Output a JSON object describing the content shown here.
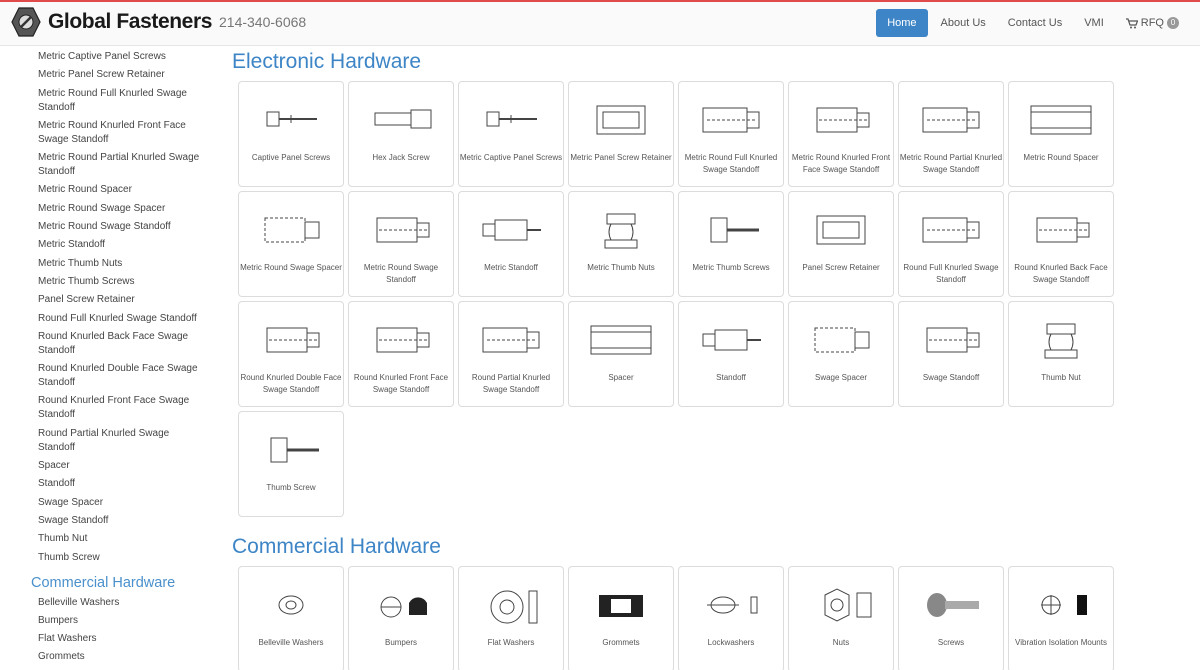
{
  "header": {
    "brand": "Global Fasteners",
    "phone": "214-340-6068",
    "nav": [
      {
        "label": "Home",
        "active": true
      },
      {
        "label": "About Us",
        "active": false
      },
      {
        "label": "Contact Us",
        "active": false
      },
      {
        "label": "VMI",
        "active": false
      }
    ],
    "rfq_label": "RFQ",
    "rfq_count": "0"
  },
  "sidebar": {
    "electronic_items": [
      "Metric Captive Panel Screws",
      "Metric Panel Screw Retainer",
      "Metric Round Full Knurled Swage Standoff",
      "Metric Round Knurled Front Face Swage Standoff",
      "Metric Round Partial Knurled Swage Standoff",
      "Metric Round Spacer",
      "Metric Round Swage Spacer",
      "Metric Round Swage Standoff",
      "Metric Standoff",
      "Metric Thumb Nuts",
      "Metric Thumb Screws",
      "Panel Screw Retainer",
      "Round Full Knurled Swage Standoff",
      "Round Knurled Back Face Swage Standoff",
      "Round Knurled Double Face Swage Standoff",
      "Round Knurled Front Face Swage Standoff",
      "Round Partial Knurled Swage Standoff",
      "Spacer",
      "Standoff",
      "Swage Spacer",
      "Swage Standoff",
      "Thumb Nut",
      "Thumb Screw"
    ],
    "commercial_heading": "Commercial Hardware",
    "commercial_items": [
      "Belleville Washers",
      "Bumpers",
      "Flat Washers",
      "Grommets"
    ]
  },
  "main": {
    "electronic_title": "Electronic Hardware",
    "electronic_cards": [
      {
        "label": "Captive Panel Screws",
        "icon": "captive-screw"
      },
      {
        "label": "Hex Jack Screw",
        "icon": "hex-jack"
      },
      {
        "label": "Metric Captive Panel Screws",
        "icon": "captive-screw"
      },
      {
        "label": "Metric Panel Screw Retainer",
        "icon": "retainer"
      },
      {
        "label": "Metric Round Full Knurled Swage Standoff",
        "icon": "knurled"
      },
      {
        "label": "Metric Round Knurled Front Face Swage Standoff",
        "icon": "standoff"
      },
      {
        "label": "Metric Round Partial Knurled Swage Standoff",
        "icon": "knurled"
      },
      {
        "label": "Metric Round Spacer",
        "icon": "spacer"
      },
      {
        "label": "Metric Round Swage Spacer",
        "icon": "swage-spacer"
      },
      {
        "label": "Metric Round Swage Standoff",
        "icon": "standoff"
      },
      {
        "label": "Metric Standoff",
        "icon": "threaded"
      },
      {
        "label": "Metric Thumb Nuts",
        "icon": "thumb-nut"
      },
      {
        "label": "Metric Thumb Screws",
        "icon": "thumb-screw"
      },
      {
        "label": "Panel Screw Retainer",
        "icon": "retainer"
      },
      {
        "label": "Round Full Knurled Swage Standoff",
        "icon": "knurled"
      },
      {
        "label": "Round Knurled Back Face Swage Standoff",
        "icon": "standoff"
      },
      {
        "label": "Round Knurled Double Face Swage Standoff",
        "icon": "standoff"
      },
      {
        "label": "Round Knurled Front Face Swage Standoff",
        "icon": "standoff"
      },
      {
        "label": "Round Partial Knurled Swage Standoff",
        "icon": "knurled"
      },
      {
        "label": "Spacer",
        "icon": "spacer"
      },
      {
        "label": "Standoff",
        "icon": "threaded"
      },
      {
        "label": "Swage Spacer",
        "icon": "swage-spacer"
      },
      {
        "label": "Swage Standoff",
        "icon": "standoff"
      },
      {
        "label": "Thumb Nut",
        "icon": "thumb-nut"
      },
      {
        "label": "Thumb Screw",
        "icon": "thumb-screw"
      }
    ],
    "commercial_title": "Commercial Hardware",
    "commercial_cards": [
      {
        "label": "Belleville Washers",
        "icon": "washer"
      },
      {
        "label": "Bumpers",
        "icon": "bumper"
      },
      {
        "label": "Flat Washers",
        "icon": "flat-washer"
      },
      {
        "label": "Grommets",
        "icon": "grommet"
      },
      {
        "label": "Lockwashers",
        "icon": "lockwasher"
      },
      {
        "label": "Nuts",
        "icon": "nut"
      },
      {
        "label": "Screws",
        "icon": "screw"
      },
      {
        "label": "Vibration Isolation Mounts",
        "icon": "mount"
      }
    ]
  }
}
